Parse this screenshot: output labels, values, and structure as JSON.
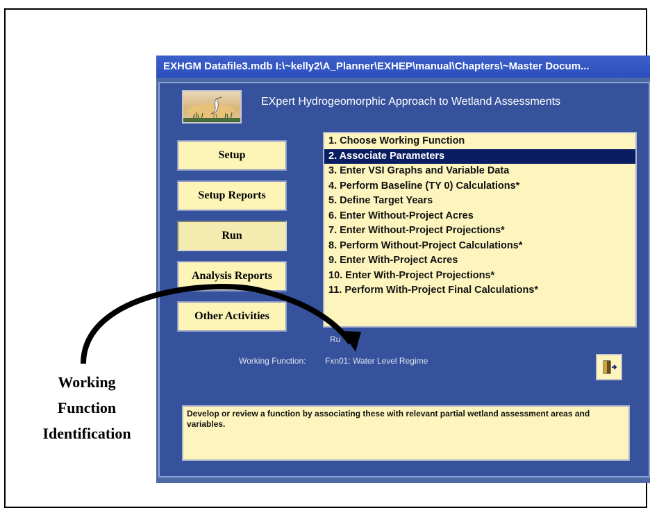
{
  "window": {
    "title": "EXHGM    Datafile3.mdb    I:\\~kelly2\\A_Planner\\EXHEP\\manual\\Chapters\\~Master Docum..."
  },
  "app": {
    "heading": "EXpert Hydrogeomorphic Approach to Wetland Assessments",
    "logo_icon": "heron-wetland-logo"
  },
  "nav": {
    "buttons": [
      {
        "label": "Setup"
      },
      {
        "label": "Setup Reports"
      },
      {
        "label": "Run"
      },
      {
        "label": "Analysis Reports"
      },
      {
        "label": "Other Activities"
      }
    ],
    "active": "Run"
  },
  "steps": {
    "selected_index": 1,
    "items": [
      {
        "label": "1.  Choose Working Function"
      },
      {
        "label": "2.  Associate Parameters"
      },
      {
        "label": "3.  Enter VSI Graphs and Variable Data"
      },
      {
        "label": "4.  Perform Baseline (TY 0) Calculations*"
      },
      {
        "label": "5.  Define Target Years"
      },
      {
        "label": "6.  Enter Without-Project Acres"
      },
      {
        "label": "7.  Enter Without-Project Projections*"
      },
      {
        "label": "8.  Perform Without-Project Calculations*"
      },
      {
        "label": "9.  Enter With-Project Acres"
      },
      {
        "label": "10. Enter With-Project Projections*"
      },
      {
        "label": "11. Perform With-Project Final Calculations*"
      }
    ]
  },
  "status": {
    "run_caption": "Ru",
    "working_function_label": "Working Function:",
    "working_function_value": "Fxn01: Water Level Regime"
  },
  "exit_button": {
    "icon": "exit-door-icon"
  },
  "description": "Develop or review a function by associating these with relevant partial wetland assessment areas and variables.",
  "callout": {
    "lines": [
      "Working",
      "Function",
      "Identification"
    ]
  },
  "colors": {
    "titlebar": "#2b4fbf",
    "panel": "#36529c",
    "button_face": "#fdf5b8",
    "selection": "#0b1d62"
  }
}
